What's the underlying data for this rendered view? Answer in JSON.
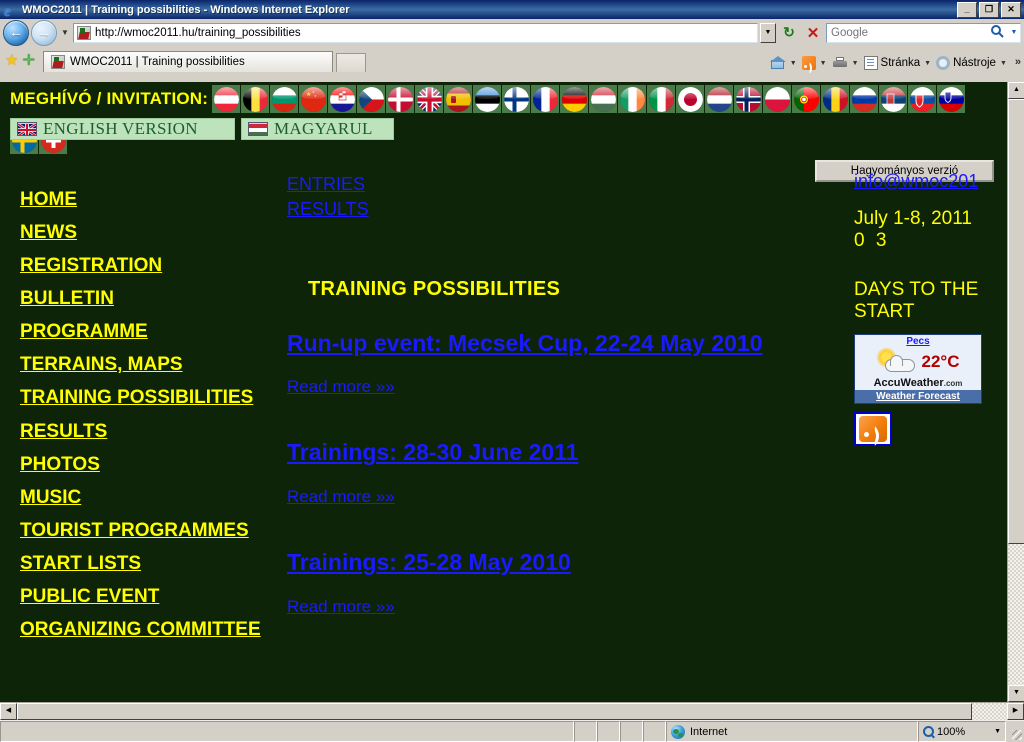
{
  "window": {
    "title": "WMOC2011 | Training possibilities - Windows Internet Explorer",
    "minimize_label": "_",
    "restore_label": "❐",
    "close_label": "✕"
  },
  "browser": {
    "back_label": "←",
    "forward_label": "→",
    "history_caret": "▼",
    "url": "http://wmoc2011.hu/training_possibilities",
    "url_combo_caret": "▼",
    "refresh_label": "↻",
    "stop_label": "✕",
    "search_placeholder": "Google",
    "search_value": "",
    "search_go_label": "🔍",
    "search_caret": "▼",
    "tab_title": "WMOC2011 | Training possibilities",
    "new_tab_label": "",
    "favorites_star": "★",
    "add_favorite_star": "✛",
    "toolbar": {
      "home_label": "",
      "feeds_label": "",
      "print_label": "",
      "page_label": "Stránka",
      "tools_label": "Nástroje",
      "overflow_label": "»",
      "caret": "▼"
    }
  },
  "status": {
    "message": "",
    "zone_label": "Internet",
    "zoom_label": "100%",
    "zoom_caret": "▼"
  },
  "site": {
    "invitation_label": "MEGHÍVÓ / INVITATION:",
    "flags": [
      {
        "name": "austria-flag",
        "code": "at"
      },
      {
        "name": "belgium-flag",
        "code": "be"
      },
      {
        "name": "bulgaria-flag",
        "code": "bg"
      },
      {
        "name": "china-flag",
        "code": "cn"
      },
      {
        "name": "croatia-flag",
        "code": "hr"
      },
      {
        "name": "czech-republic-flag",
        "code": "cz"
      },
      {
        "name": "denmark-flag",
        "code": "dk"
      },
      {
        "name": "united-kingdom-flag",
        "code": "gb"
      },
      {
        "name": "spain-flag",
        "code": "es"
      },
      {
        "name": "estonia-flag",
        "code": "ee"
      },
      {
        "name": "finland-flag",
        "code": "fi"
      },
      {
        "name": "france-flag",
        "code": "fr"
      },
      {
        "name": "germany-flag",
        "code": "de"
      },
      {
        "name": "hungary-flag",
        "code": "hu"
      },
      {
        "name": "ireland-flag",
        "code": "ie"
      },
      {
        "name": "italy-flag",
        "code": "it"
      },
      {
        "name": "japan-flag",
        "code": "jp"
      },
      {
        "name": "netherlands-flag",
        "code": "nl"
      },
      {
        "name": "norway-flag",
        "code": "no"
      },
      {
        "name": "poland-flag",
        "code": "pl"
      },
      {
        "name": "portugal-flag",
        "code": "pt"
      },
      {
        "name": "romania-flag",
        "code": "ro"
      },
      {
        "name": "russia-flag",
        "code": "ru"
      },
      {
        "name": "serbia-flag",
        "code": "rs"
      },
      {
        "name": "slovakia-flag",
        "code": "sk"
      },
      {
        "name": "slovenia-flag",
        "code": "si"
      }
    ],
    "extra_flags": [
      {
        "name": "sweden-flag",
        "code": "se"
      },
      {
        "name": "switzerland-flag",
        "code": "ch"
      }
    ],
    "english_version_label": "ENGLISH VERSION",
    "magyarul_label": "MAGYARUL",
    "traditional_version_label": "Hagyományos verzió",
    "nav": [
      {
        "label": "HOME",
        "name": "nav-home"
      },
      {
        "label": "NEWS",
        "name": "nav-news"
      },
      {
        "label": "REGISTRATION",
        "name": "nav-registration"
      },
      {
        "label": "BULLETIN",
        "name": "nav-bulletin"
      },
      {
        "label": "PROGRAMME",
        "name": "nav-programme"
      },
      {
        "label": "TERRAINS, MAPS",
        "name": "nav-terrains-maps"
      },
      {
        "label": "TRAINING POSSIBILITIES",
        "name": "nav-training-possibilities"
      },
      {
        "label": "RESULTS",
        "name": "nav-results"
      },
      {
        "label": "PHOTOS",
        "name": "nav-photos"
      },
      {
        "label": "MUSIC",
        "name": "nav-music"
      },
      {
        "label": "TOURIST PROGRAMMES",
        "name": "nav-tourist-programmes"
      },
      {
        "label": "START LISTS",
        "name": "nav-start-lists"
      },
      {
        "label": "PUBLIC EVENT",
        "name": "nav-public-event"
      },
      {
        "label": "ORGANIZING COMMITTEE",
        "name": "nav-organizing-committee"
      }
    ],
    "top_links": [
      {
        "label": "ENTRIES",
        "name": "link-entries"
      },
      {
        "label": "RESULTS",
        "name": "link-results"
      }
    ],
    "page_title": "TRAINING POSSIBILITIES",
    "articles": [
      {
        "title": "Run-up event: Mecsek Cup, 22-24 May 2010",
        "read_more": "Read more »»"
      },
      {
        "title": "Trainings: 28-30 June 2011",
        "read_more": "Read more »»"
      },
      {
        "title": "Trainings: 25-28 May 2010",
        "read_more": "Read more »»"
      }
    ],
    "contact_email": "info@wmoc201",
    "event_date": "July 1-8, 2011",
    "countdown": "0 3",
    "countdown_caption": "DAYS TO THE START",
    "weather": {
      "city": "Pecs",
      "temperature": "22°C",
      "brand": "AccuWeather",
      "brand_suffix": ".com",
      "forecast_label": "Weather Forecast"
    },
    "rss_label": "RSS feed"
  },
  "scroll": {
    "up_label": "▲",
    "down_label": "▼",
    "left_label": "◀",
    "right_label": "▶"
  },
  "colors": {
    "page_bg": "#0d2408",
    "nav_link": "#ffff00",
    "content_link": "#1a1aff",
    "lang_bar_bg": "#bce3bc",
    "lang_bar_text": "#1f5c2e",
    "flag_cell_bg": "#4a7c4a",
    "rss_orange": "#f07d0d",
    "titlebar_blue": "#0a246a",
    "chrome_gray": "#d4d0c8"
  }
}
